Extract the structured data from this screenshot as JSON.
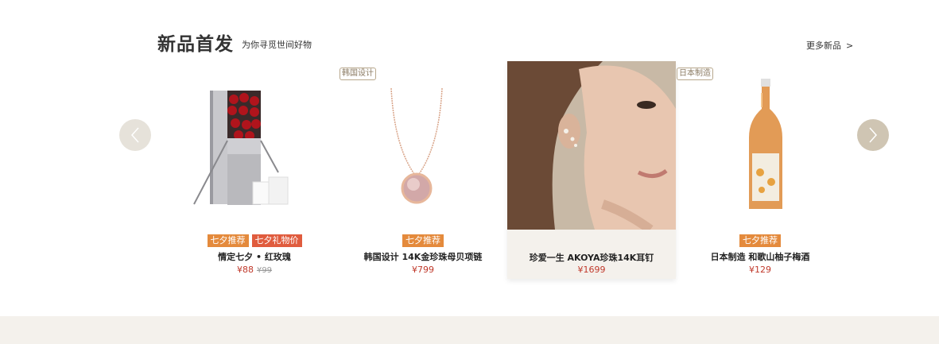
{
  "section": {
    "title": "新品首发",
    "subtitle": "为你寻觅世间好物",
    "more_label": "更多新品",
    "more_chevron": ">"
  },
  "nav": {
    "prev_icon": "chevron-left-icon",
    "next_icon": "chevron-right-icon"
  },
  "colors": {
    "price": "#c0392b",
    "tag_orange": "#e48a3c",
    "tag_red": "#e05c3e",
    "band": "#f4f1ec"
  },
  "products": [
    {
      "origin_tag": "",
      "tags": [
        "七夕推荐",
        "七夕礼物价"
      ],
      "name": "情定七夕 • 红玫瑰",
      "price": "¥88",
      "old_price": "¥99",
      "image": "rose-gift-box"
    },
    {
      "origin_tag": "韩国设计",
      "tags": [
        "七夕推荐"
      ],
      "name": "韩国设计 14K金珍珠母贝项链",
      "price": "¥799",
      "old_price": "",
      "image": "pink-pendant-necklace"
    },
    {
      "origin_tag": "",
      "tags": [],
      "name": "珍爱一生 AKOYA珍珠14K耳钉",
      "price": "¥1699",
      "old_price": "",
      "image": "model-pearl-earring"
    },
    {
      "origin_tag": "日本制造",
      "tags": [
        "七夕推荐"
      ],
      "name": "日本制造 和歌山柚子梅酒",
      "price": "¥129",
      "old_price": "",
      "image": "plum-wine-bottle"
    }
  ]
}
